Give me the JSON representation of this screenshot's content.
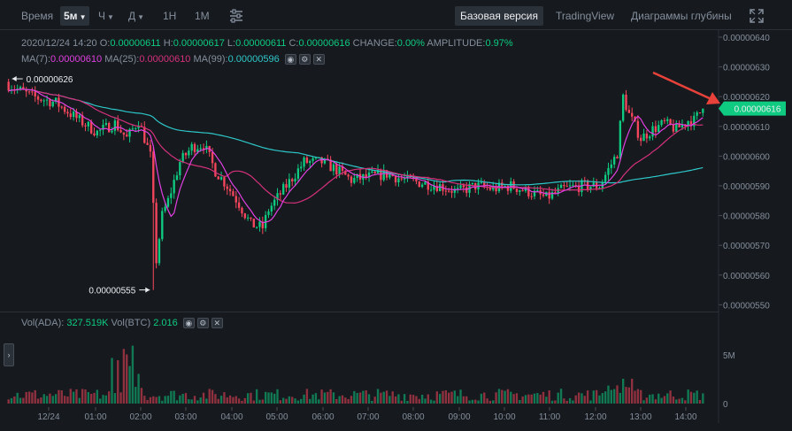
{
  "toolbar": {
    "time_label": "Время",
    "interval_active": "5м",
    "hour_menu": "Ч",
    "day_menu": "Д",
    "week_label": "1Н",
    "month_label": "1М",
    "basic_label": "Базовая версия",
    "tradingview_label": "TradingView",
    "depth_label": "Диаграммы глубины"
  },
  "info": {
    "datetime": "2020/12/24 14:20",
    "open_label": "O:",
    "open": "0.00000611",
    "high_label": "H:",
    "high": "0.00000617",
    "low_label": "L:",
    "low": "0.00000611",
    "close_label": "C:",
    "close": "0.00000616",
    "change_label": "CHANGE:",
    "change": "0.00%",
    "amplitude_label": "AMPLITUDE:",
    "amplitude": "0.97%",
    "ma7_label": "MA(7):",
    "ma7": "0.00000610",
    "ma25_label": "MA(25):",
    "ma25": "0.00000610",
    "ma99_label": "MA(99):",
    "ma99": "0.00000596"
  },
  "volume_info": {
    "ada_label": "Vol(ADA):",
    "ada": "327.519K",
    "btc_label": "Vol(BTC)",
    "btc": "2.016"
  },
  "price_axis": [
    "0.00000640",
    "0.00000630",
    "0.00000620",
    "0.00000610",
    "0.00000600",
    "0.00000590",
    "0.00000580",
    "0.00000570",
    "0.00000560",
    "0.00000550"
  ],
  "volume_axis": [
    "5M",
    "0"
  ],
  "time_axis": [
    "12/24",
    "01:00",
    "02:00",
    "03:00",
    "04:00",
    "05:00",
    "06:00",
    "07:00",
    "08:00",
    "09:00",
    "10:00",
    "11:00",
    "12:00",
    "13:00",
    "14:00"
  ],
  "markers": {
    "high": "0.00000626",
    "low": "0.00000555",
    "last": "0.00000616"
  },
  "colors": {
    "up": "#0ecb81",
    "down": "#f6465d",
    "ma7": "#e03fe0",
    "ma25": "#d4307c",
    "ma99": "#2ec7c9",
    "annotation_arrow": "#e8423b"
  },
  "icons": {
    "settings": "sliders-icon",
    "fullscreen": "fullscreen-icon",
    "eye": "eye-icon",
    "gear": "gear-icon",
    "close": "close-icon",
    "expand": "chevron-right-icon"
  }
}
